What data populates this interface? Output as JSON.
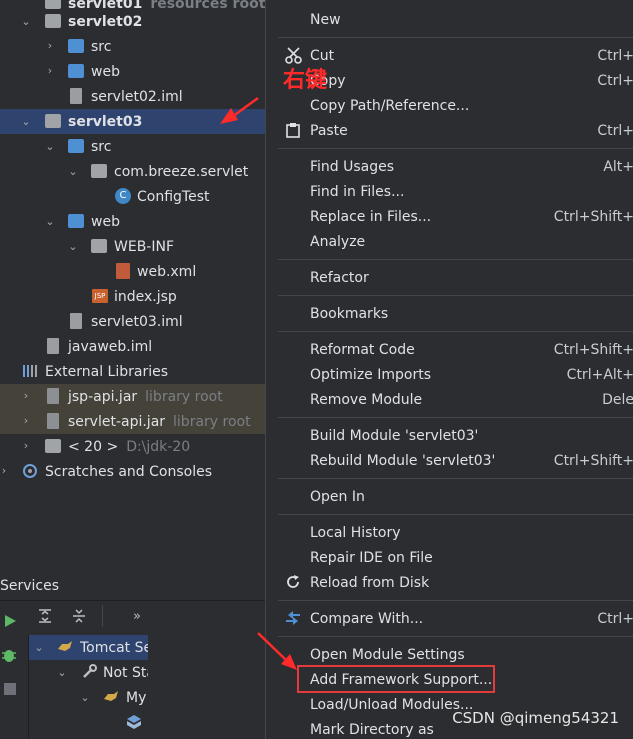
{
  "tree": {
    "rows": [
      {
        "label": "servlet01",
        "hint": "resources root"
      },
      {
        "label": "servlet02"
      },
      {
        "label": "src"
      },
      {
        "label": "web"
      },
      {
        "label": "servlet02.iml"
      },
      {
        "label": "servlet03"
      },
      {
        "label": "src"
      },
      {
        "label": "com.breeze.servlet"
      },
      {
        "label": "ConfigTest"
      },
      {
        "label": "web"
      },
      {
        "label": "WEB-INF"
      },
      {
        "label": "web.xml"
      },
      {
        "label": "index.jsp"
      },
      {
        "label": "servlet03.iml"
      },
      {
        "label": "javaweb.iml"
      },
      {
        "label": "External Libraries"
      },
      {
        "label": "jsp-api.jar",
        "hint": "library root"
      },
      {
        "label": "servlet-api.jar",
        "hint": "library root"
      },
      {
        "label": "< 20 >",
        "hint": "D:\\jdk-20"
      },
      {
        "label": "Scratches and Consoles"
      }
    ]
  },
  "services": {
    "title": "Services",
    "more": "»",
    "items": [
      {
        "label": "Tomcat Se"
      },
      {
        "label": "Not Sta"
      },
      {
        "label": "My"
      }
    ]
  },
  "menu": {
    "items": [
      {
        "label": "New",
        "shortcut": ""
      },
      {
        "label": "Cut",
        "shortcut": "Ctrl+"
      },
      {
        "label": "Copy",
        "shortcut": "Ctrl+"
      },
      {
        "label": "Copy Path/Reference...",
        "shortcut": ""
      },
      {
        "label": "Paste",
        "shortcut": "Ctrl+"
      },
      {
        "label": "Find Usages",
        "shortcut": "Alt+"
      },
      {
        "label": "Find in Files...",
        "shortcut": ""
      },
      {
        "label": "Replace in Files...",
        "shortcut": "Ctrl+Shift+"
      },
      {
        "label": "Analyze",
        "shortcut": ""
      },
      {
        "label": "Refactor",
        "shortcut": ""
      },
      {
        "label": "Bookmarks",
        "shortcut": ""
      },
      {
        "label": "Reformat Code",
        "shortcut": "Ctrl+Shift+"
      },
      {
        "label": "Optimize Imports",
        "shortcut": "Ctrl+Alt+"
      },
      {
        "label": "Remove Module",
        "shortcut": "Dele"
      },
      {
        "label": "Build Module 'servlet03'",
        "shortcut": ""
      },
      {
        "label": "Rebuild Module 'servlet03'",
        "shortcut": "Ctrl+Shift+"
      },
      {
        "label": "Open In",
        "shortcut": ""
      },
      {
        "label": "Local History",
        "shortcut": ""
      },
      {
        "label": "Repair IDE on File",
        "shortcut": ""
      },
      {
        "label": "Reload from Disk",
        "shortcut": ""
      },
      {
        "label": "Compare With...",
        "shortcut": "Ctrl+"
      },
      {
        "label": "Open Module Settings",
        "shortcut": ""
      },
      {
        "label": "Add Framework Support...",
        "shortcut": ""
      },
      {
        "label": "Load/Unload Modules...",
        "shortcut": ""
      },
      {
        "label": "Mark Directory as",
        "shortcut": ""
      }
    ]
  },
  "annotation": {
    "text": "右键"
  },
  "watermark": "CSDN @qimeng54321",
  "colors": {
    "accent_selection": "#2e436e",
    "annotation_red": "#ff2a2a",
    "folder_blue": "#4f8fd4"
  }
}
